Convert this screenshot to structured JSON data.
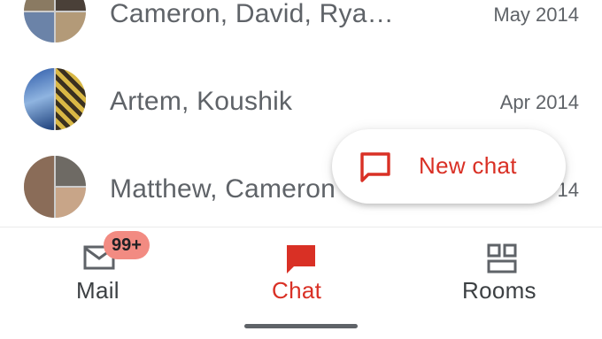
{
  "conversations": [
    {
      "title": "Cameron, David, Rya…",
      "date": "May 2014"
    },
    {
      "title": "Artem, Koushik",
      "date": "Apr 2014"
    },
    {
      "title": "Matthew, Cameron",
      "date": "14"
    }
  ],
  "fab": {
    "label": "New chat",
    "icon": "chat-outline-icon"
  },
  "bottom_nav": {
    "mail": {
      "label": "Mail",
      "badge": "99+",
      "icon": "mail-icon"
    },
    "chat": {
      "label": "Chat",
      "icon": "chat-filled-icon",
      "active": true
    },
    "rooms": {
      "label": "Rooms",
      "icon": "rooms-grid-icon"
    }
  },
  "colors": {
    "accent": "#d93025",
    "badge_bg": "#f28b82",
    "text_secondary": "#5f6368"
  }
}
